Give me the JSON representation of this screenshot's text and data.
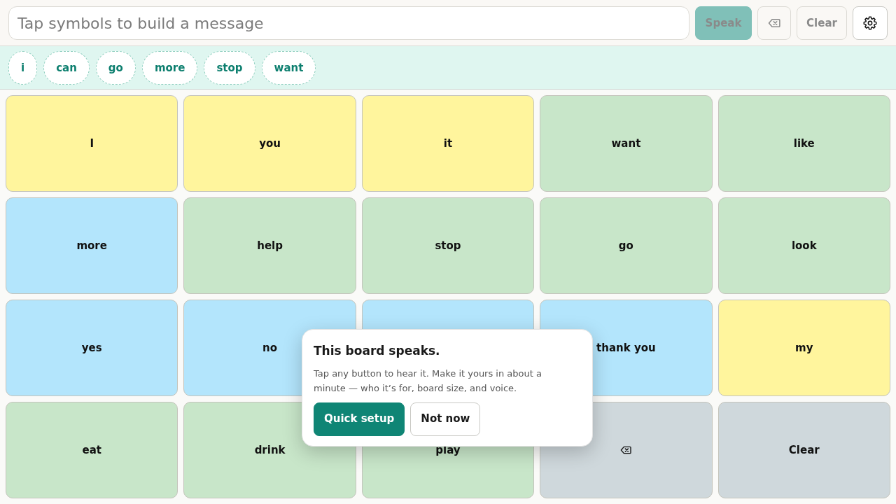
{
  "message_bar": {
    "placeholder": "Tap symbols to build a message",
    "speak": {
      "label": "Speak",
      "disabled": true
    },
    "backspace": {
      "disabled": true
    },
    "clear": {
      "label": "Clear",
      "disabled": true
    }
  },
  "suggestions": [
    "i",
    "can",
    "go",
    "more",
    "stop",
    "want"
  ],
  "board": {
    "tiles": [
      {
        "kind": "text",
        "label": "I",
        "color": "#fff59d"
      },
      {
        "kind": "text",
        "label": "you",
        "color": "#fff59d"
      },
      {
        "kind": "text",
        "label": "it",
        "color": "#fff59d"
      },
      {
        "kind": "text",
        "label": "want",
        "color": "#c8e6c9"
      },
      {
        "kind": "text",
        "label": "like",
        "color": "#c8e6c9"
      },
      {
        "kind": "text",
        "label": "more",
        "color": "#b3e5fc"
      },
      {
        "kind": "text",
        "label": "help",
        "color": "#c8e6c9"
      },
      {
        "kind": "text",
        "label": "stop",
        "color": "#c8e6c9"
      },
      {
        "kind": "text",
        "label": "go",
        "color": "#c8e6c9"
      },
      {
        "kind": "text",
        "label": "look",
        "color": "#c8e6c9"
      },
      {
        "kind": "text",
        "label": "yes",
        "color": "#b3e5fc"
      },
      {
        "kind": "text",
        "label": "no",
        "color": "#b3e5fc"
      },
      {
        "kind": "text",
        "color": "#b3e5fc"
      },
      {
        "kind": "text",
        "label": "thank you",
        "color": "#b3e5fc"
      },
      {
        "kind": "text",
        "label": "my",
        "color": "#fff59d"
      },
      {
        "kind": "text",
        "label": "eat",
        "color": "#c8e6c9"
      },
      {
        "kind": "text",
        "label": "drink",
        "color": "#c8e6c9"
      },
      {
        "kind": "text",
        "label": "play",
        "color": "#c8e6c9"
      },
      {
        "kind": "backspace",
        "color": "#cfd8dc"
      },
      {
        "kind": "text",
        "label": "Clear",
        "color": "#cfd8dc"
      }
    ]
  },
  "popover": {
    "title": "This board speaks.",
    "text": "Tap any button to hear it. Make it yours in about a minute — who it’s for, board size, and voice.",
    "buttons": [
      {
        "kind": "primary",
        "label": "Quick setup"
      },
      {
        "kind": "secondary",
        "label": "Not now"
      }
    ]
  }
}
